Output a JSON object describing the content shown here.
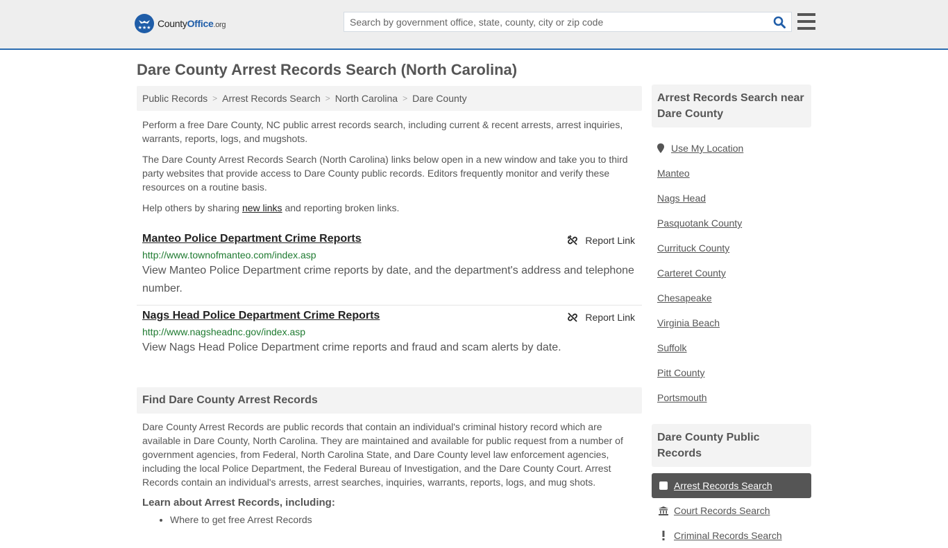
{
  "header": {
    "logo": {
      "prefix": "County",
      "brand": "Office",
      "tld": ".org"
    },
    "search": {
      "placeholder": "Search by government office, state, county, city or zip code",
      "value": ""
    },
    "icons": {
      "search": "search-icon",
      "menu": "hamburger-menu-icon"
    },
    "accent_color": "#1f5da8"
  },
  "page": {
    "title": "Dare County Arrest Records Search (North Carolina)",
    "breadcrumb": [
      "Public Records",
      "Arrest Records Search",
      "North Carolina",
      "Dare County"
    ],
    "intro": [
      "Perform a free Dare County, NC public arrest records search, including current & recent arrests, arrest inquiries, warrants, reports, logs, and mugshots.",
      "The Dare County Arrest Records Search (North Carolina) links below open in a new window and take you to third party websites that provide access to Dare County public records. Editors frequently monitor and verify these resources on a routine basis."
    ],
    "help": {
      "before": "Help others by sharing ",
      "link": "new links",
      "after": " and reporting broken links."
    },
    "links": [
      {
        "title": "Manteo Police Department Crime Reports",
        "url": "http://www.townofmanteo.com/index.asp",
        "description": "View Manteo Police Department crime reports by date, and the department's address and telephone number.",
        "report_label": "Report Link"
      },
      {
        "title": "Nags Head Police Department Crime Reports",
        "url": "http://www.nagsheadnc.gov/index.asp",
        "description": "View Nags Head Police Department crime reports and fraud and scam alerts by date.",
        "report_label": "Report Link"
      }
    ],
    "find_section": {
      "heading": "Find Dare County Arrest Records",
      "body": "Dare County Arrest Records are public records that contain an individual's criminal history record which are available in Dare County, North Carolina. They are maintained and available for public request from a number of government agencies, from Federal, North Carolina State, and Dare County level law enforcement agencies, including the local Police Department, the Federal Bureau of Investigation, and the Dare County Court. Arrest Records contain an individual's arrests, arrest searches, inquiries, warrants, reports, logs, and mug shots.",
      "learn_heading": "Learn about Arrest Records, including:",
      "learn_items": [
        "Where to get free Arrest Records"
      ]
    }
  },
  "sidebar": {
    "nearby_heading": "Arrest Records Search near Dare County",
    "use_location": "Use My Location",
    "nearby": [
      "Manteo",
      "Nags Head",
      "Pasquotank County",
      "Currituck County",
      "Carteret County",
      "Chesapeake",
      "Virginia Beach",
      "Suffolk",
      "Pitt County",
      "Portsmouth"
    ],
    "records_heading": "Dare County Public Records",
    "records": [
      {
        "label": "Arrest Records Search",
        "icon": "square-icon",
        "active": true
      },
      {
        "label": "Court Records Search",
        "icon": "courthouse-icon",
        "active": false
      },
      {
        "label": "Criminal Records Search",
        "icon": "exclamation-icon",
        "active": false
      }
    ]
  }
}
